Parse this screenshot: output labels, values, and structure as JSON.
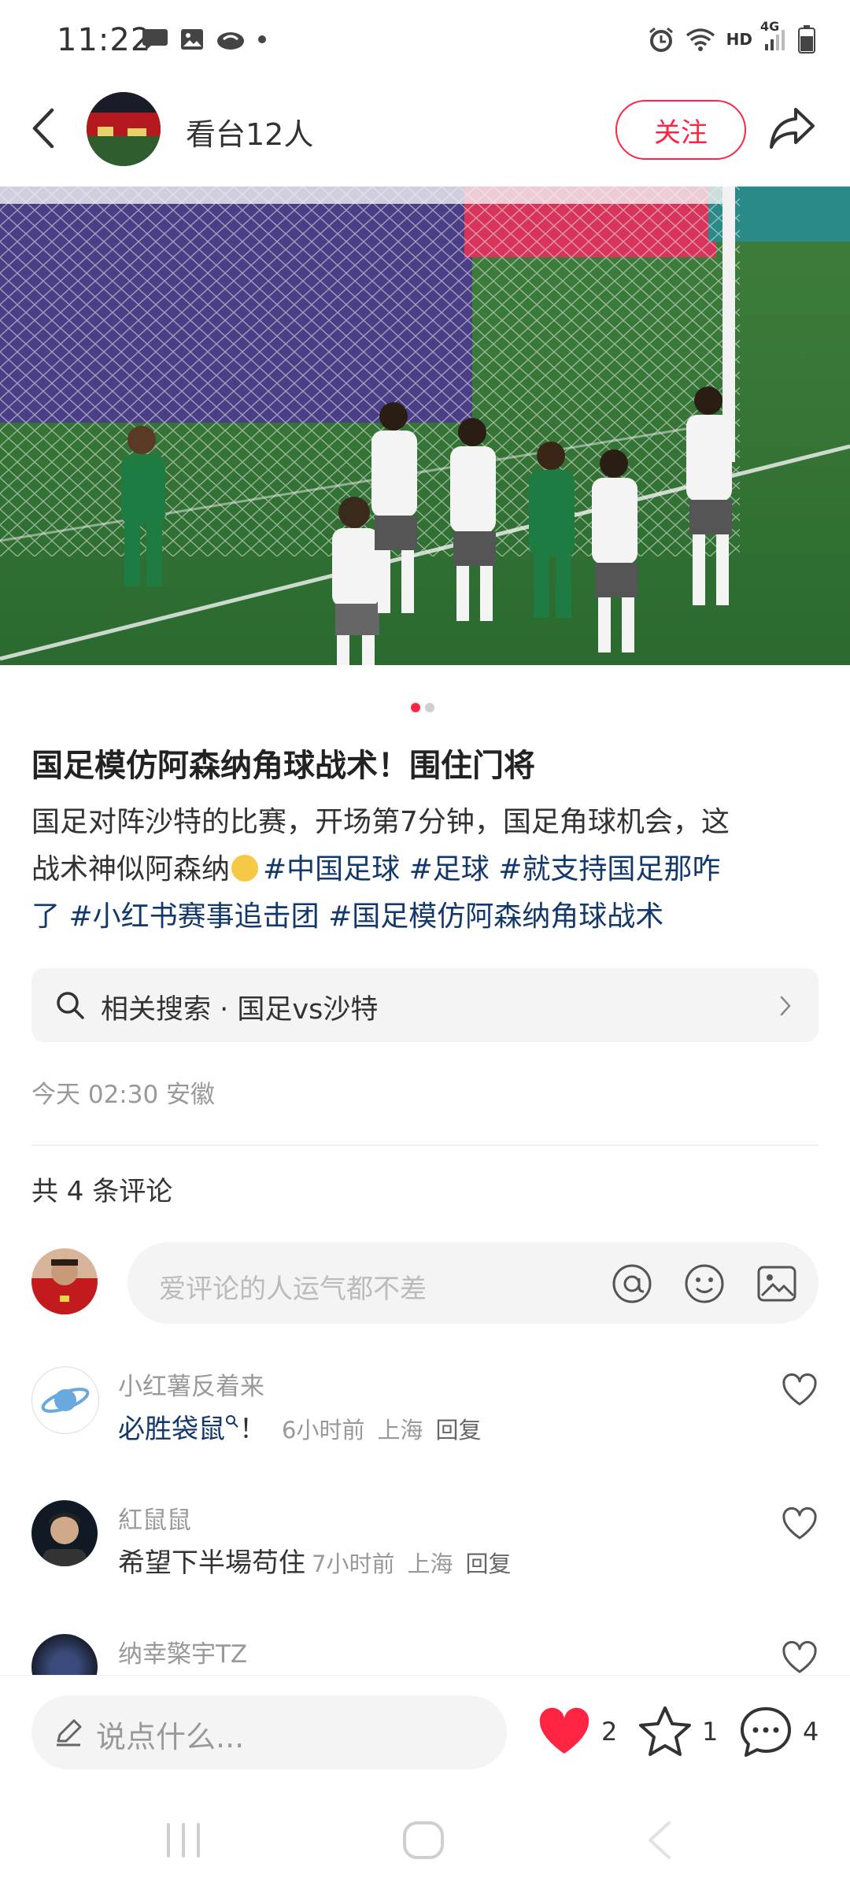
{
  "status_bar": {
    "time": "11:22",
    "left_icons": [
      "chat-bubble-icon",
      "image-icon",
      "cloud-icon",
      "dot-icon"
    ],
    "right_icons": [
      "alarm-icon",
      "wifi-icon",
      "hd-icon",
      "signal-4g-icon",
      "battery-icon"
    ],
    "hd_label": "HD",
    "network_label": "4G"
  },
  "header": {
    "author_name": "看台12人",
    "follow_label": "关注"
  },
  "carousel": {
    "total": 2,
    "active_index": 0
  },
  "post": {
    "title": "国足模仿阿森纳角球战术！围住门将",
    "body_line1": "国足对阵沙特的比赛，开场第7分钟，国足角球机会，这",
    "body_line2_prefix": "战术神似阿森纳",
    "tags": [
      "#中国足球",
      "#足球",
      "#就支持国足那咋了",
      "#小红书赛事追击团",
      "#国足模仿阿森纳角球战术"
    ],
    "tag_line2": [
      "#中国足球",
      "#足球",
      "#就支持国足那咋"
    ],
    "tag_line3_prefix": "了",
    "tag_line3": [
      "#小红书赛事追击团",
      "#国足模仿阿森纳角球战术"
    ],
    "related_search": "相关搜索 · 国足vs沙特",
    "meta": "今天 02:30 安徽"
  },
  "comments_section": {
    "count_label": "共 4 条评论",
    "input_placeholder": "爱评论的人运气都不差",
    "comments": [
      {
        "name": "小红薯反着来",
        "body": "必胜袋鼠",
        "body_suffix": "！",
        "time": "6小时前",
        "location": "上海",
        "reply": "回复"
      },
      {
        "name": "紅鼠鼠",
        "body": "希望下半場苟住",
        "time": "7小时前",
        "location": "上海",
        "reply": "回复"
      },
      {
        "name": "纳幸檠宇TZ"
      }
    ]
  },
  "bottom_bar": {
    "input_placeholder": "说点什么...",
    "likes": "2",
    "collects": "1",
    "comments": "4"
  },
  "colors": {
    "brand": "#ff2442",
    "tag": "#13386c",
    "muted": "#999999"
  }
}
